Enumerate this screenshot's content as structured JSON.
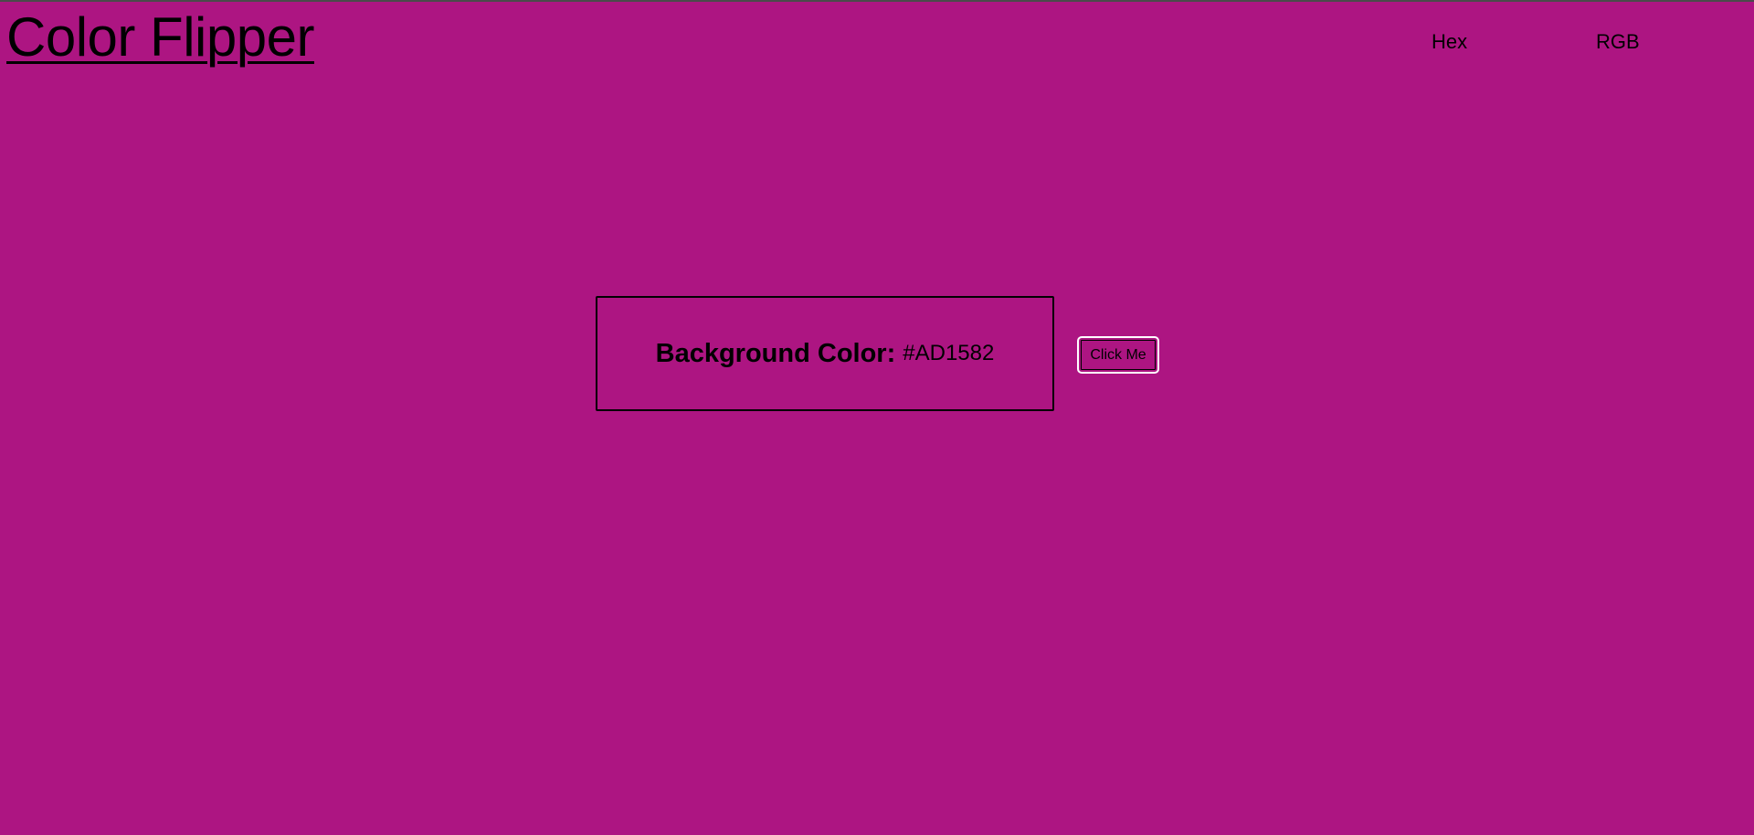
{
  "header": {
    "title": "Color Flipper"
  },
  "nav": {
    "items": [
      {
        "label": "Hex"
      },
      {
        "label": "RGB"
      }
    ]
  },
  "main": {
    "label": "Background Color:",
    "value": "#AD1582",
    "button_label": "Click Me"
  },
  "colors": {
    "background": "#AD1582",
    "text": "#000000",
    "button_border": "#FFFFFF"
  }
}
